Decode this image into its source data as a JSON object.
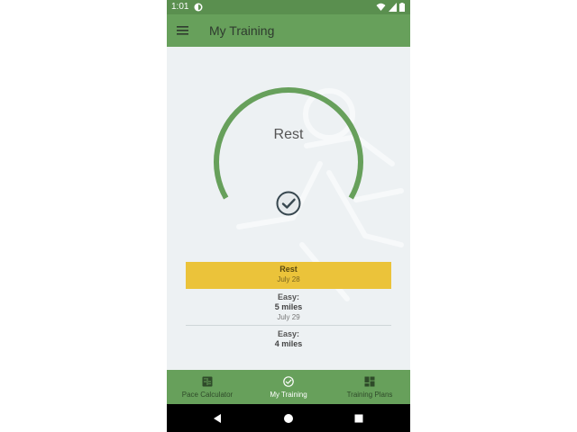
{
  "status_bar": {
    "time": "1:01",
    "icons": [
      "app-notification-icon",
      "wifi-icon",
      "cellular-icon",
      "battery-icon"
    ]
  },
  "app_bar": {
    "title": "My Training",
    "menu_icon": "hamburger-menu-icon"
  },
  "gauge": {
    "label": "Rest",
    "progress": 1.0,
    "color": "#67a05b",
    "status_icon": "check-circle-icon"
  },
  "plan_list": {
    "items": [
      {
        "type": "Rest",
        "distance": "",
        "date": "July 28",
        "active": true
      },
      {
        "type": "Easy:",
        "distance": "5 miles",
        "date": "July 29",
        "active": false
      },
      {
        "type": "Easy:",
        "distance": "4 miles",
        "date": "",
        "active": false
      }
    ],
    "highlight_color": "#ebc33a"
  },
  "bottom_nav": {
    "tabs": [
      {
        "label": "Pace Calculator",
        "icon": "calculator-icon",
        "selected": false
      },
      {
        "label": "My Training",
        "icon": "check-circle-icon",
        "selected": true
      },
      {
        "label": "Training Plans",
        "icon": "dashboard-icon",
        "selected": false
      }
    ]
  },
  "colors": {
    "primary": "#67a05b",
    "primary_dark": "#5a8f4f",
    "background": "#edf1f3",
    "accent": "#ebc33a"
  }
}
